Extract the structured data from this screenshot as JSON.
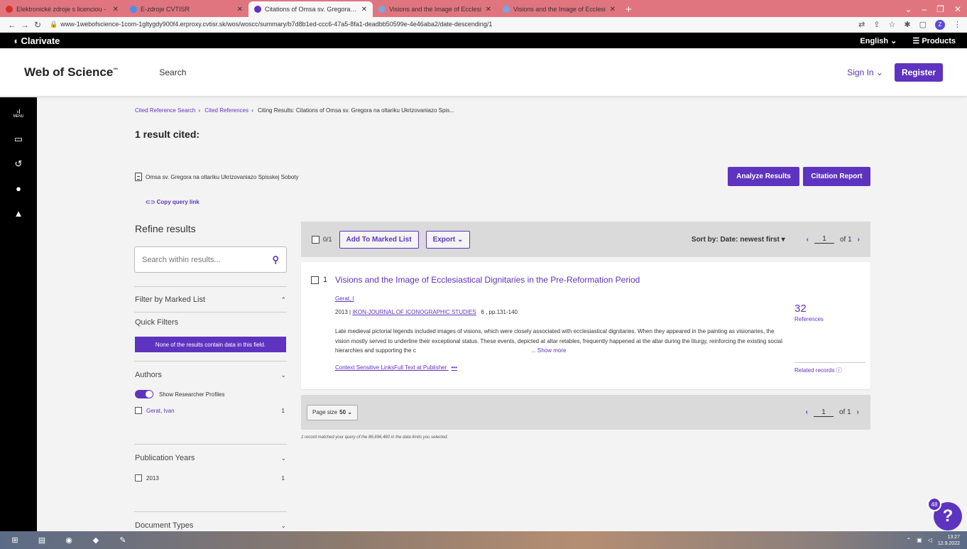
{
  "browser": {
    "tabs": [
      {
        "title": "Elektronické zdroje s licenciou - ",
        "active": false,
        "fav_color": "#d93025"
      },
      {
        "title": "E-zdroje CVTISR",
        "active": false,
        "fav_color": "#4a8ef0"
      },
      {
        "title": "Citations of Omsa sv. Gregora na",
        "active": true,
        "fav_color": "#5e33bf"
      },
      {
        "title": "Visions and the Image of Ecclesi",
        "active": false,
        "fav_color": "#7aa7e0"
      },
      {
        "title": "Visions and the Image of Ecclesi",
        "active": false,
        "fav_color": "#7aa7e0"
      }
    ],
    "url": "www-1webofscience-1com-1gltygdy900f4.erproxy.cvtisr.sk/wos/woscc/summary/b7d8b1ed-ccc6-47a5-8fa1-deadbb50599e-4e46aba2/date-descending/1",
    "profile_letter": "Z"
  },
  "clarivate": {
    "brand": "Clarivate",
    "language": "English ⌄",
    "products": "☰ Products"
  },
  "header": {
    "logo": "Web of Science",
    "logo_tm": "™",
    "search": "Search",
    "sign_in": "Sign In ⌄",
    "register": "Register"
  },
  "rail": {
    "menu": "›I",
    "menu_label": "MENU"
  },
  "breadcrumb": {
    "item1": "Cited Reference Search",
    "item2": "Cited References",
    "current": "Citing Results: Citations of Omsa sv. Gregora na oltariku Ukrizovaniazo Spis..."
  },
  "results": {
    "heading": "1 result cited:",
    "query": "Omsa sv. Gregora na oltariku Ukrizovaniazo Spisskej Soboty",
    "copy_link": "Copy query link",
    "analyze": "Analyze Results",
    "citation_report": "Citation Report"
  },
  "refine": {
    "title": "Refine results",
    "search_placeholder": "Search within results...",
    "marked_list": "Filter by Marked List",
    "quick_filters": "Quick Filters",
    "none_msg": "None of the results contain data in this field.",
    "authors": "Authors",
    "show_profiles": "Show Researcher Profiles",
    "author_item": "Gerat, Ivan",
    "author_count": "1",
    "pub_years": "Publication Years",
    "year_item": "2013",
    "year_count": "1",
    "doc_types": "Document Types"
  },
  "toolbar": {
    "selected": "0/1",
    "add_marked": "Add To Marked List",
    "export": "Export ⌄",
    "sort": "Sort by: Date: newest first ▾",
    "page": "1",
    "of": "of 1"
  },
  "record": {
    "index": "1",
    "title": "Visions and the Image of Ecclesiastical Dignitaries in the Pre-Reformation Period",
    "author": "Gerat, I",
    "year": "2013 |",
    "journal": "IKON-JOURNAL OF ICONOGRAPHIC STUDIES",
    "pages": "6 , pp.131-140",
    "abstract": "Late medieval pictorial legends included images of visions, which were closely associated with ecclesiastical dignitaries. When they appeared in the painting as visionaries, the vision mostly served to underline their exceptional status. These events, depicted at altar retables, frequently happened at the altar during the liturgy, reinforcing the existing social hierarchies and supporting the c",
    "show_more": "... Show more",
    "link_context": "Context Sensitive Links",
    "link_fulltext": "Full Text at Publisher",
    "more_dots": "•••",
    "ref_count": "32",
    "ref_label": "References",
    "related": "Related records"
  },
  "bottom": {
    "page_size_label": "Page size",
    "page_size_value": "50 ⌄",
    "page": "1",
    "of": "of 1",
    "matched": "1 record matched your query of the 86,696,460 in the data limits you selected."
  },
  "help": {
    "count": "48",
    "label": "?"
  },
  "taskbar": {
    "time": "13:27",
    "date": "12.9.2022"
  }
}
